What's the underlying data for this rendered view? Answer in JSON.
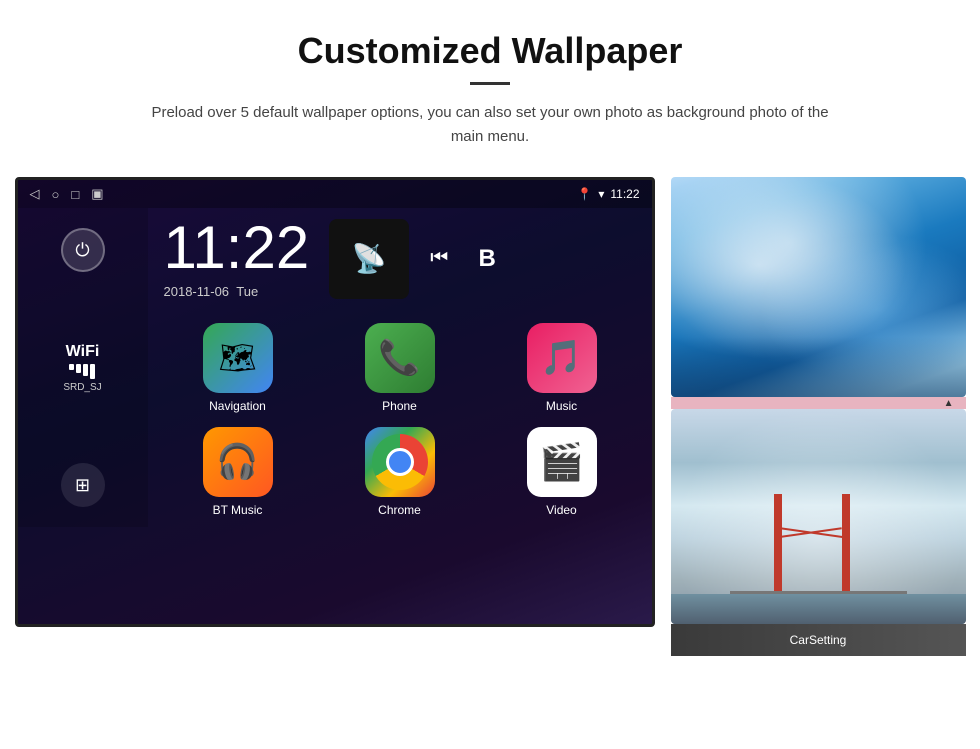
{
  "header": {
    "title": "Customized Wallpaper",
    "subtitle": "Preload over 5 default wallpaper options, you can also set your own photo as background photo of the main menu."
  },
  "android": {
    "statusBar": {
      "navIcons": [
        "◁",
        "○",
        "□",
        "▣"
      ],
      "rightIcons": [
        "location",
        "wifi",
        "time"
      ],
      "time": "11:22"
    },
    "clock": {
      "time": "11:22",
      "date": "2018-11-06",
      "day": "Tue"
    },
    "sidebar": {
      "powerLabel": "⏻",
      "wifi": {
        "label": "WiFi",
        "ssid": "SRD_SJ"
      },
      "appsIcon": "⊞"
    },
    "apps": [
      {
        "id": "navigation",
        "label": "Navigation",
        "icon": "nav"
      },
      {
        "id": "phone",
        "label": "Phone",
        "icon": "phone"
      },
      {
        "id": "music",
        "label": "Music",
        "icon": "music"
      },
      {
        "id": "bt-music",
        "label": "BT Music",
        "icon": "bt"
      },
      {
        "id": "chrome",
        "label": "Chrome",
        "icon": "chrome"
      },
      {
        "id": "video",
        "label": "Video",
        "icon": "video"
      }
    ],
    "wallpapers": {
      "label": "CarSetting"
    }
  }
}
